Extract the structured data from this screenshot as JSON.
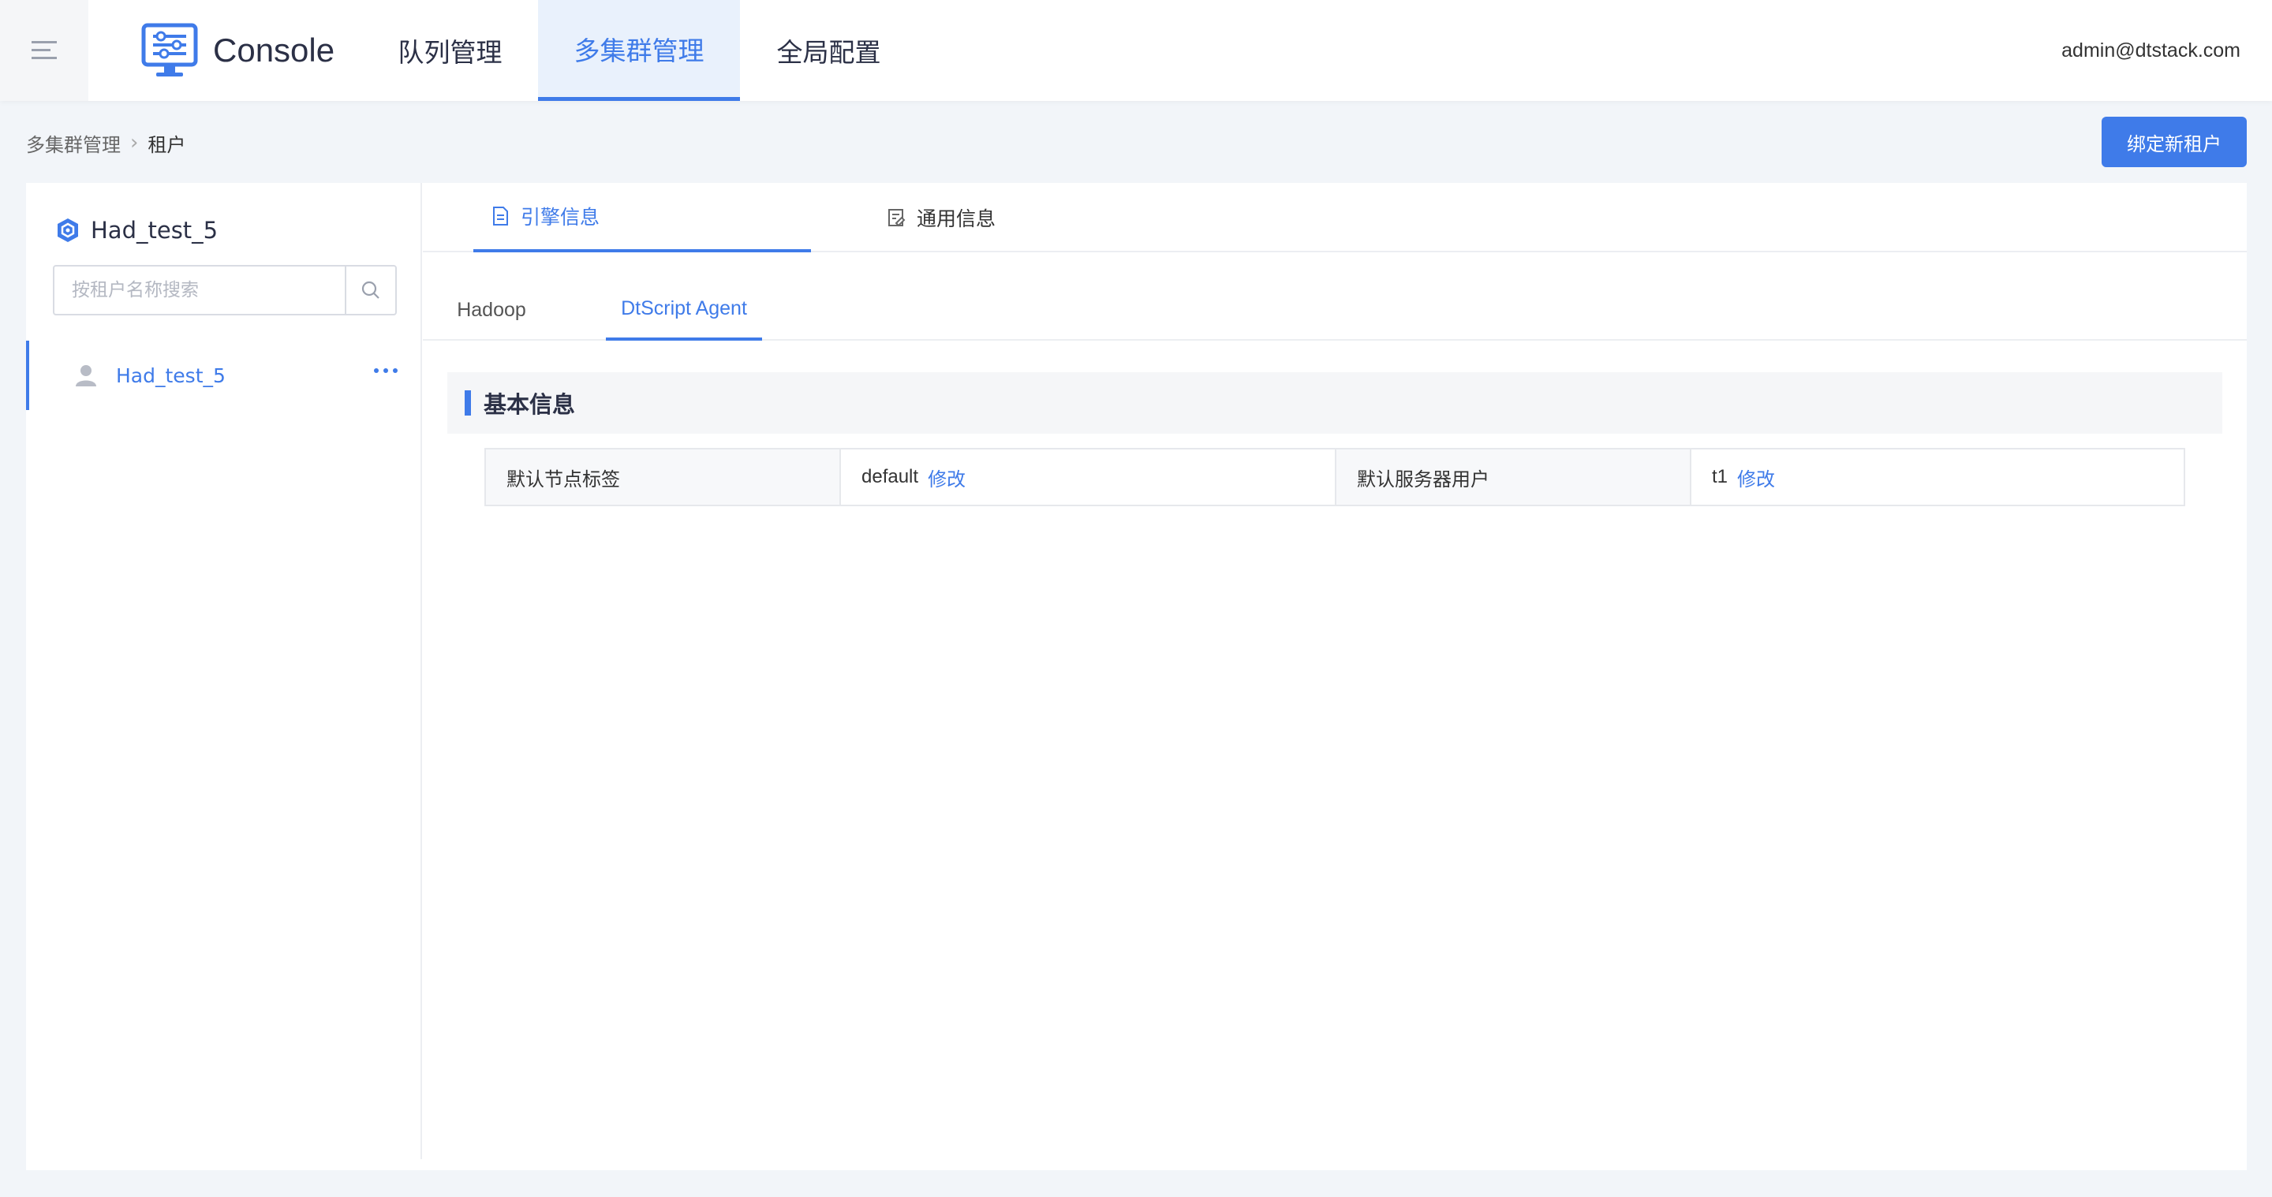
{
  "app": {
    "brand": "Console",
    "nav_tabs": [
      "队列管理",
      "多集群管理",
      "全局配置"
    ],
    "active_nav": "多集群管理",
    "user_email": "admin@dtstack.com"
  },
  "breadcrumb": [
    "多集群管理",
    "租户"
  ],
  "bind_button": "绑定新租户",
  "sidebar": {
    "title": "Had_test_5",
    "search_placeholder": "按租户名称搜索",
    "items": [
      {
        "name": "Had_test_5",
        "selected": true
      }
    ]
  },
  "tabs": {
    "primary": [
      "引擎信息",
      "通用信息"
    ],
    "primary_active": "引擎信息",
    "secondary": [
      "Hadoop",
      "DtScript Agent"
    ],
    "secondary_active": "DtScript Agent"
  },
  "section": {
    "title": "基本信息",
    "fields": [
      {
        "label": "默认节点标签",
        "value": "default",
        "action": "修改"
      },
      {
        "label": "默认服务器用户",
        "value": "t1",
        "action": "修改"
      }
    ]
  },
  "colors": {
    "accent": "#3f7be9",
    "text": "#2b3046",
    "background": "#f2f5f9"
  }
}
